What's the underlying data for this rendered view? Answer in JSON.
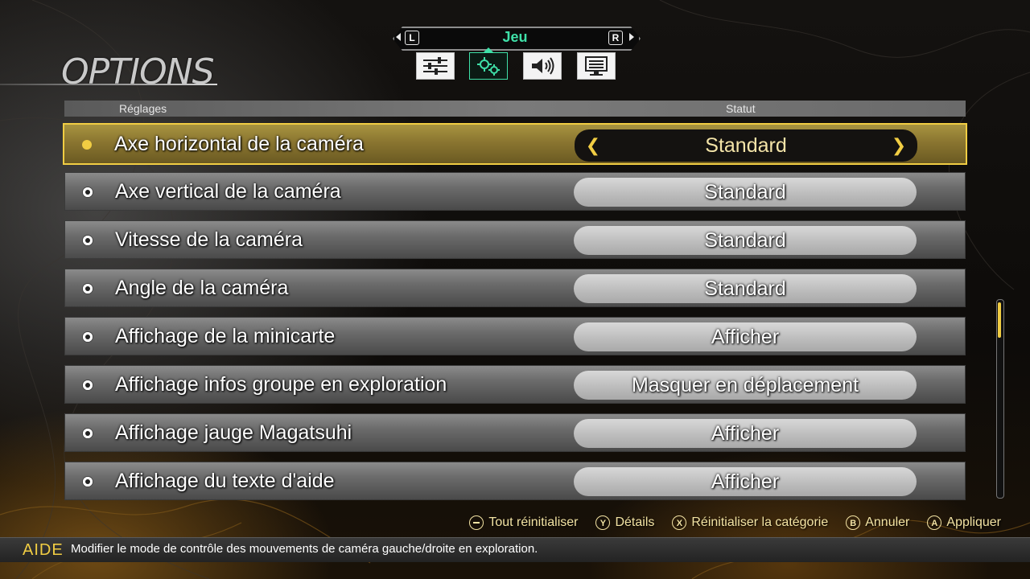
{
  "screen": {
    "title": "OPTIONS"
  },
  "category": {
    "name": "Jeu",
    "left_button": "L",
    "right_button": "R",
    "tabs": [
      {
        "icon": "sliders-icon",
        "active": false
      },
      {
        "icon": "gears-icon",
        "active": true
      },
      {
        "icon": "speaker-icon",
        "active": false
      },
      {
        "icon": "monitor-icon",
        "active": false
      }
    ]
  },
  "columns": {
    "setting": "Réglages",
    "status": "Statut"
  },
  "rows": [
    {
      "label": "Axe horizontal de la caméra",
      "value": "Standard",
      "selected": true
    },
    {
      "label": "Axe vertical de la caméra",
      "value": "Standard",
      "selected": false
    },
    {
      "label": "Vitesse de la caméra",
      "value": "Standard",
      "selected": false
    },
    {
      "label": "Angle de la caméra",
      "value": "Standard",
      "selected": false
    },
    {
      "label": "Affichage de la minicarte",
      "value": "Afficher",
      "selected": false
    },
    {
      "label": "Affichage infos groupe en exploration",
      "value": "Masquer en déplacement",
      "selected": false
    },
    {
      "label": "Affichage jauge Magatsuhi",
      "value": "Afficher",
      "selected": false
    },
    {
      "label": "Affichage du texte d'aide",
      "value": "Afficher",
      "selected": false
    }
  ],
  "hints": [
    {
      "button": "−",
      "label": "Tout réinitialiser"
    },
    {
      "button": "Y",
      "label": "Détails"
    },
    {
      "button": "X",
      "label": "Réinitialiser la catégorie"
    },
    {
      "button": "B",
      "label": "Annuler"
    },
    {
      "button": "A",
      "label": "Appliquer"
    }
  ],
  "help": {
    "label": "AIDE",
    "text": "Modifier le mode de contrôle des mouvements de caméra gauche/droite en exploration."
  },
  "colors": {
    "accent_gold": "#f1cd43",
    "tab_active": "#3fe0a8"
  }
}
